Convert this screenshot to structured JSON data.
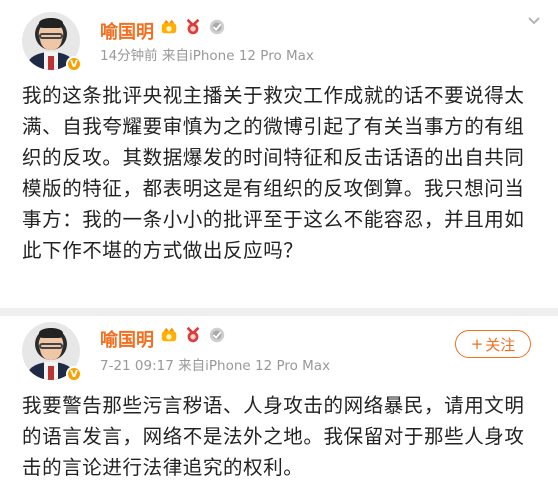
{
  "posts": [
    {
      "author": "喻国明",
      "meta": "14分钟前   来自iPhone 12 Pro Max",
      "text": "我的这条批评央视主播关于救灾工作成就的话不要说得太满、自我夸耀要审慎为之的微博引起了有关当事方的有组织的反攻。其数据爆发的时间特征和反击话语的出自共同模版的特征，都表明这是有组织的反攻倒算。我只想问当事方：我的一条小小的批评至于这么不能容忍，并且用如此下作不堪的方式做出反应吗？"
    },
    {
      "author": "喻国明",
      "meta": "7-21 09:17   来自iPhone 12 Pro Max",
      "follow_label": "关注",
      "text": "我要警告那些污言秽语、人身攻击的网络暴民，请用文明的语言发言，网络不是法外之地。我保留对于那些人身攻击的言论进行法律追究的权利。"
    }
  ],
  "colors": {
    "accent": "#f36f20",
    "meta": "#999999",
    "text": "#222222",
    "divider": "#eeeeee",
    "verified": "#f7a200"
  },
  "icons": [
    "avatar",
    "verified-icon",
    "vip-crown-icon",
    "medal-icon",
    "badge-icon",
    "chevron-down-icon",
    "plus-icon"
  ]
}
